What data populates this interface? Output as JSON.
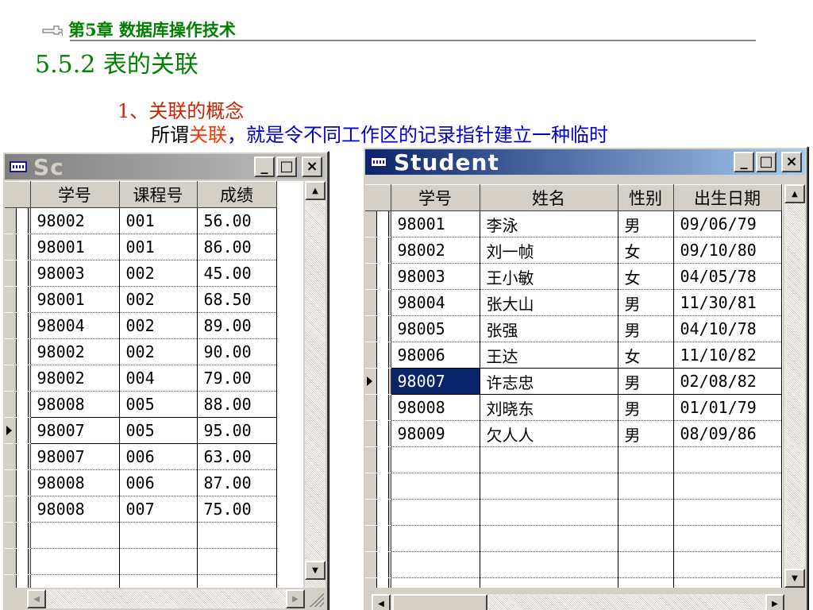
{
  "slide": {
    "chapter": "第5章  数据库操作技术",
    "section": "5.5.2   表的关联",
    "subheading": "1、关联的概念",
    "para_part1": "所谓",
    "para_part2": "关联",
    "para_part3": "，就是令不同工作区的记录指针建立一种临时"
  },
  "sc_window": {
    "title": "Sc",
    "min_label": "_",
    "max_label": "□",
    "close_label": "×",
    "columns": [
      "学号",
      "课程号",
      "成绩"
    ],
    "rows": [
      [
        "98002",
        "001",
        "56.00"
      ],
      [
        "98001",
        "001",
        "86.00"
      ],
      [
        "98003",
        "002",
        "45.00"
      ],
      [
        "98001",
        "002",
        "68.50"
      ],
      [
        "98004",
        "002",
        "89.00"
      ],
      [
        "98002",
        "002",
        "90.00"
      ],
      [
        "98002",
        "004",
        "79.00"
      ],
      [
        "98008",
        "005",
        "88.00"
      ],
      [
        "98007",
        "005",
        "95.00"
      ],
      [
        "98007",
        "006",
        "63.00"
      ],
      [
        "98008",
        "006",
        "87.00"
      ],
      [
        "98008",
        "007",
        "75.00"
      ]
    ],
    "current_row": 8
  },
  "student_window": {
    "title": "Student",
    "min_label": "_",
    "max_label": "□",
    "close_label": "×",
    "columns": [
      "学号",
      "姓名",
      "性别",
      "出生日期"
    ],
    "rows": [
      [
        "98001",
        "李泳",
        "男",
        "09/06/79"
      ],
      [
        "98002",
        "刘一帧",
        "女",
        "09/10/80"
      ],
      [
        "98003",
        "王小敏",
        "女",
        "04/05/78"
      ],
      [
        "98004",
        "张大山",
        "男",
        "11/30/81"
      ],
      [
        "98005",
        "张强",
        "男",
        "04/10/78"
      ],
      [
        "98006",
        "王达",
        "女",
        "11/10/82"
      ],
      [
        "98007",
        "许志忠",
        "男",
        "02/08/82"
      ],
      [
        "98008",
        "刘晓东",
        "男",
        "01/01/79"
      ],
      [
        "98009",
        "欠人人",
        "男",
        "08/09/86"
      ]
    ],
    "current_row": 6
  },
  "colors": {
    "title_green": "#008000",
    "sub_red": "#cc2200",
    "para_blue": "#0000cc",
    "active_title": "#0a246a",
    "selection": "#0a246a"
  },
  "icons": {
    "window_icon": "table-icon",
    "scroll_up": "triangle-up",
    "scroll_down": "triangle-down",
    "scroll_left": "triangle-left",
    "scroll_right": "triangle-right"
  }
}
